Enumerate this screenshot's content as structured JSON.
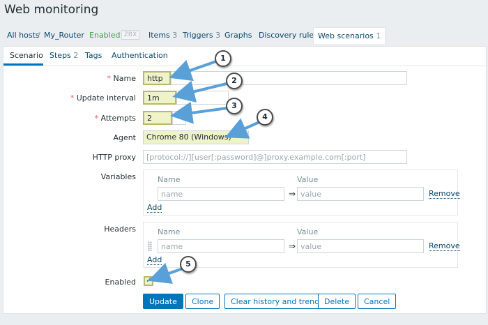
{
  "page_title": "Web monitoring",
  "breadcrumbs": {
    "all_hosts": "All hosts",
    "separator": "/",
    "host": "My_Router",
    "enabled": "Enabled",
    "zbx": "ZBX",
    "items_label": "Items",
    "items_count": "3",
    "triggers_label": "Triggers",
    "triggers_count": "3",
    "graphs": "Graphs",
    "discovery": "Discovery rules",
    "web_label": "Web scenarios",
    "web_count": "1"
  },
  "tabs": {
    "scenario": "Scenario",
    "steps_label": "Steps",
    "steps_count": "2",
    "tags": "Tags",
    "authentication": "Authentication"
  },
  "form": {
    "required_mark": "*",
    "name_label": "Name",
    "name_value": "http",
    "interval_label": "Update interval",
    "interval_value": "1m",
    "attempts_label": "Attempts",
    "attempts_value": "2",
    "agent_label": "Agent",
    "agent_value": "Chrome 80 (Windows)",
    "proxy_label": "HTTP proxy",
    "proxy_placeholder": "[protocol://][user[:password]@]proxy.example.com[:port]",
    "variables_label": "Variables",
    "headers_label": "Headers",
    "col_name": "Name",
    "col_value": "Value",
    "name_placeholder": "name",
    "value_placeholder": "value",
    "arrow": "⇒",
    "remove": "Remove",
    "add": "Add",
    "enabled_label": "Enabled",
    "enabled_checked": true
  },
  "buttons": {
    "update": "Update",
    "clone": "Clone",
    "clear_history": "Clear history and trends",
    "delete": "Delete",
    "cancel": "Cancel"
  },
  "callouts": [
    "1",
    "2",
    "3",
    "4",
    "5"
  ],
  "colors": {
    "accent": "#0275b8",
    "highlight": "#eff3c8",
    "callout_arrow": "#5aa0d8",
    "required": "#e45959",
    "enabled_green": "#429e47"
  }
}
